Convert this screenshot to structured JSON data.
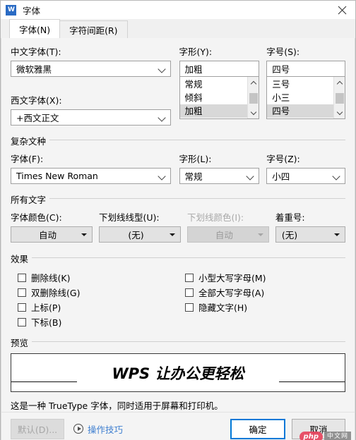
{
  "window": {
    "title": "字体",
    "app_icon": "wps-icon",
    "close_icon": "close-icon"
  },
  "tabs": [
    {
      "label": "字体(N)",
      "active": true
    },
    {
      "label": "字符间距(R)",
      "active": false
    }
  ],
  "latin_section": {
    "chinese_font_label": "中文字体(T):",
    "chinese_font_value": "微软雅黑",
    "western_font_label": "西文字体(X):",
    "western_font_value": "+西文正文",
    "style_label": "字形(Y):",
    "style_value": "加粗",
    "style_options": [
      "常规",
      "倾斜",
      "加粗"
    ],
    "style_selected": "加粗",
    "size_label": "字号(S):",
    "size_value": "四号",
    "size_options": [
      "三号",
      "小三",
      "四号"
    ],
    "size_selected": "四号"
  },
  "complex_section": {
    "group_title": "复杂文种",
    "font_label": "字体(F):",
    "font_value": "Times New Roman",
    "style_label": "字形(L):",
    "style_value": "常规",
    "size_label": "字号(Z):",
    "size_value": "小四"
  },
  "all_text_section": {
    "group_title": "所有文字",
    "font_color_label": "字体颜色(C):",
    "font_color_value": "自动",
    "underline_style_label": "下划线线型(U):",
    "underline_style_value": "(无)",
    "underline_color_label": "下划线颜色(I):",
    "underline_color_value": "自动",
    "underline_color_disabled": true,
    "emphasis_label": "着重号:",
    "emphasis_value": "(无)"
  },
  "effects_section": {
    "group_title": "效果",
    "left_items": [
      {
        "label": "删除线(K)",
        "checked": false
      },
      {
        "label": "双删除线(G)",
        "checked": false
      },
      {
        "label": "上标(P)",
        "checked": false
      },
      {
        "label": "下标(B)",
        "checked": false
      }
    ],
    "right_items": [
      {
        "label": "小型大写字母(M)",
        "checked": false
      },
      {
        "label": "全部大写字母(A)",
        "checked": false
      },
      {
        "label": "隐藏文字(H)",
        "checked": false
      }
    ]
  },
  "preview_section": {
    "group_title": "预览",
    "sample_text": "WPS 让办公更轻松",
    "note": "这是一种 TrueType 字体，同时适用于屏幕和打印机。"
  },
  "footer": {
    "default_button": "默认(D)...",
    "default_disabled": true,
    "tips_label": "操作技巧",
    "tips_icon": "play-circle-icon",
    "ok_button": "确定",
    "cancel_button": "取消"
  },
  "watermark": {
    "brand": "php",
    "suffix": "中文网"
  },
  "colors": {
    "accent": "#0078d7",
    "link": "#3f7fd0",
    "dialog_bg": "#f4f4f4",
    "selection": "#d8d8d8"
  }
}
